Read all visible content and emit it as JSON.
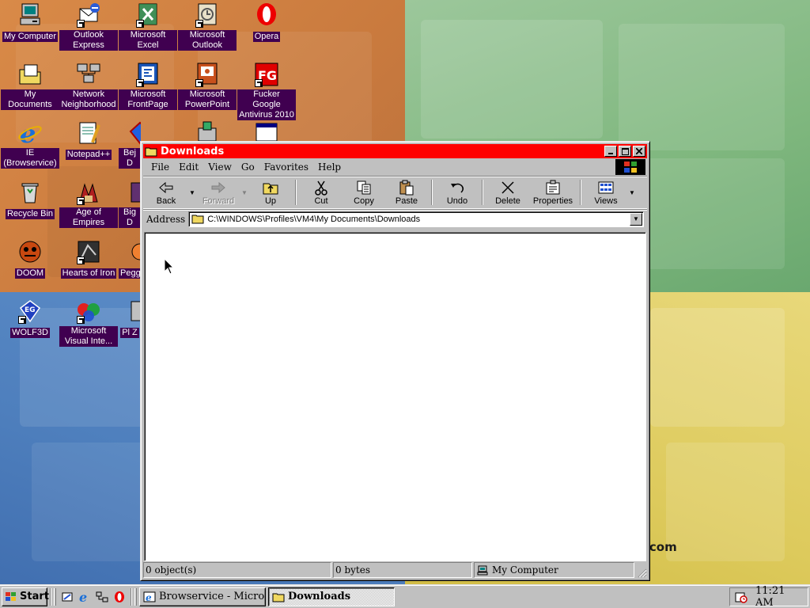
{
  "desktop": {
    "icons": [
      {
        "label": "My Computer",
        "icon": "my-computer-icon"
      },
      {
        "label": "Outlook Express",
        "icon": "outlook-express-icon"
      },
      {
        "label": "Microsoft Excel",
        "icon": "excel-icon"
      },
      {
        "label": "Microsoft Outlook",
        "icon": "outlook-icon"
      },
      {
        "label": "Opera",
        "icon": "opera-icon"
      },
      {
        "label": "My Documents",
        "icon": "my-documents-icon"
      },
      {
        "label": "Network Neighborhood",
        "icon": "network-neighborhood-icon"
      },
      {
        "label": "Microsoft FrontPage",
        "icon": "frontpage-icon"
      },
      {
        "label": "Microsoft PowerPoint",
        "icon": "powerpoint-icon"
      },
      {
        "label": "Fucker Google Antivirus 2010",
        "icon": "antivirus-icon"
      },
      {
        "label": "IE (Browservice)",
        "icon": "internet-explorer-icon"
      },
      {
        "label": "Notepad++",
        "icon": "notepad-plus-plus-icon"
      },
      {
        "label": "Bej D",
        "icon": "bejeweled-icon"
      },
      {
        "label": "Recycle Bin",
        "icon": "recycle-bin-icon"
      },
      {
        "label": "Age of Empires",
        "icon": "age-of-empires-icon"
      },
      {
        "label": "Big D",
        "icon": "game-icon"
      },
      {
        "label": "DOOM",
        "icon": "doom-icon"
      },
      {
        "label": "Hearts of Iron",
        "icon": "hearts-of-iron-icon"
      },
      {
        "label": "Pegg",
        "icon": "peggle-icon"
      },
      {
        "label": "WOLF3D",
        "icon": "wolf3d-icon"
      },
      {
        "label": "Microsoft Visual Inte...",
        "icon": "visual-interdev-icon"
      },
      {
        "label": "Pl Z",
        "icon": "game-icon"
      }
    ],
    "wallpaper_text": "t.com"
  },
  "window": {
    "title": "Downloads",
    "menu": [
      "File",
      "Edit",
      "View",
      "Go",
      "Favorites",
      "Help"
    ],
    "toolbar": {
      "back": "Back",
      "forward": "Forward",
      "up": "Up",
      "cut": "Cut",
      "copy": "Copy",
      "paste": "Paste",
      "undo": "Undo",
      "delete": "Delete",
      "properties": "Properties",
      "views": "Views"
    },
    "address": {
      "label": "Address",
      "value": "C:\\WINDOWS\\Profiles\\VM4\\My Documents\\Downloads"
    },
    "status": {
      "objects": "0 object(s)",
      "size": "0 bytes",
      "location": "My Computer"
    }
  },
  "taskbar": {
    "start": "Start",
    "tasks": [
      {
        "label": "Browservice - Micro...",
        "active": false
      },
      {
        "label": "Downloads",
        "active": true
      }
    ],
    "clock": "11:21 AM"
  },
  "colors": {
    "titlebar": "#ff0000",
    "icon_label_bg": "#400050",
    "chrome": "#c0c0c0"
  }
}
